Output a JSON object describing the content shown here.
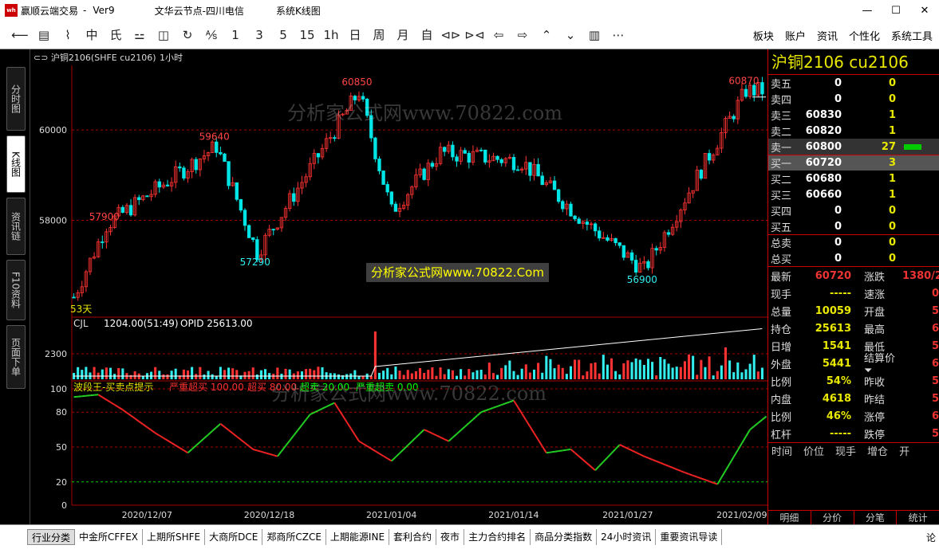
{
  "titlebar": {
    "app": "赢顺云端交易",
    "sep": "-",
    "ver": "Ver9",
    "node": "文华云节点-四川电信",
    "view": "系统K线图",
    "min": "—",
    "max": "☐",
    "close": "✕"
  },
  "toolbar": {
    "tools": [
      "⟵",
      "▤",
      "⌇",
      "中",
      "⽒",
      "⚍",
      "◫",
      "↻",
      "⅍",
      "1",
      "3",
      "5",
      "15",
      "1h",
      "日",
      "周",
      "月",
      "自",
      "⊲⊳",
      "⊳⊲",
      "⇦",
      "⇨",
      "⌃",
      "⌄",
      "▥",
      "⋯"
    ],
    "right": [
      "板块",
      "账户",
      "资讯",
      "个性化",
      "系统工具"
    ]
  },
  "lefttabs": [
    "分时图",
    "K线图",
    "资讯链",
    "F10资料",
    "页面下单"
  ],
  "chart": {
    "symbol": "⊂⊃ 沪铜2106(SHFE cu2106)",
    "period": "1小时",
    "y_labels": [
      "60000",
      "58000"
    ],
    "annot": [
      "57900",
      "59640",
      "57290",
      "60850",
      "56900",
      "60870"
    ],
    "days": "53天",
    "vol_legend": "CJL",
    "vol_value": "1204.00(51:49)",
    "opid": "OPID 25613.00",
    "vol_label": "2300",
    "ind_name": "波段王-买卖点提示",
    "ind_items": [
      "严重超买 100.00",
      "超买 80.00",
      "超卖 20.00",
      "严重超卖 0.00"
    ],
    "ind_levels": [
      "100",
      "80",
      "50",
      "20",
      "0"
    ],
    "x_dates": [
      "2020/12/07",
      "2020/12/18",
      "2021/01/04",
      "2021/01/14",
      "2021/01/27",
      "2021/02/09"
    ],
    "watermark": "分析家公式网www.70822.com",
    "watermark_box": "分析家公式网www.70822.Com"
  },
  "chart_data": {
    "type": "candlestick",
    "title": "沪铜2106(SHFE cu2106) 1小时",
    "ylim": [
      56000,
      61500
    ],
    "points": [
      [
        0,
        56300
      ],
      [
        8,
        57900
      ],
      [
        35,
        59640
      ],
      [
        45,
        57290
      ],
      [
        70,
        60850
      ],
      [
        78,
        58200
      ],
      [
        90,
        59500
      ],
      [
        110,
        59300
      ],
      [
        125,
        58000
      ],
      [
        140,
        56900
      ],
      [
        165,
        60870
      ]
    ],
    "colors": {
      "up": "#ff3333",
      "down": "#00e5e5"
    }
  },
  "right": {
    "title": "沪铜2106  cu2106",
    "book": [
      {
        "l": "卖五",
        "p": "0",
        "v": "0"
      },
      {
        "l": "卖四",
        "p": "0",
        "v": "0"
      },
      {
        "l": "卖三",
        "p": "60830",
        "v": "1"
      },
      {
        "l": "卖二",
        "p": "60820",
        "v": "1"
      },
      {
        "l": "卖一",
        "p": "60800",
        "v": "27"
      },
      {
        "l": "买一",
        "p": "60720",
        "v": "3"
      },
      {
        "l": "买二",
        "p": "60680",
        "v": "1"
      },
      {
        "l": "买三",
        "p": "60660",
        "v": "1"
      },
      {
        "l": "买四",
        "p": "0",
        "v": "0"
      },
      {
        "l": "买五",
        "p": "0",
        "v": "0"
      },
      {
        "l": "总卖",
        "p": "0",
        "v": "0"
      },
      {
        "l": "总买",
        "p": "0",
        "v": "0"
      }
    ],
    "quote": [
      {
        "a": "最新",
        "b": "60720",
        "c": "涨跌",
        "d": "1380/2"
      },
      {
        "a": "现手",
        "b": "-----",
        "c": "速涨",
        "d": "0"
      },
      {
        "a": "总量",
        "b": "10059",
        "c": "开盘",
        "d": "5"
      },
      {
        "a": "持仓",
        "b": "25613",
        "c": "最高",
        "d": "6"
      },
      {
        "a": "日增",
        "b": "1541",
        "c": "最低",
        "d": "5"
      },
      {
        "a": "外盘",
        "b": "5441",
        "c": "结算价⏷",
        "d": "6"
      },
      {
        "a": "比例",
        "b": "54%",
        "c": "昨收",
        "d": "5"
      },
      {
        "a": "内盘",
        "b": "4618",
        "c": "昨结",
        "d": "5"
      },
      {
        "a": "比例",
        "b": "46%",
        "c": "涨停",
        "d": "6"
      },
      {
        "a": "杠杆",
        "b": "-----",
        "c": "跌停",
        "d": "5"
      }
    ],
    "tick": [
      "时间",
      "价位",
      "现手",
      "增仓",
      "开"
    ],
    "tabs": [
      "明细",
      "分价",
      "分笔",
      "统计"
    ]
  },
  "bottom": [
    "行业分类",
    "中金所CFFEX",
    "上期所SHFE",
    "大商所DCE",
    "郑商所CZCE",
    "上期能源INE",
    "套利合约",
    "夜市",
    "主力合约排名",
    "商品分类指数",
    "24小时资讯",
    "重要资讯导读"
  ],
  "bottom_right": "论"
}
